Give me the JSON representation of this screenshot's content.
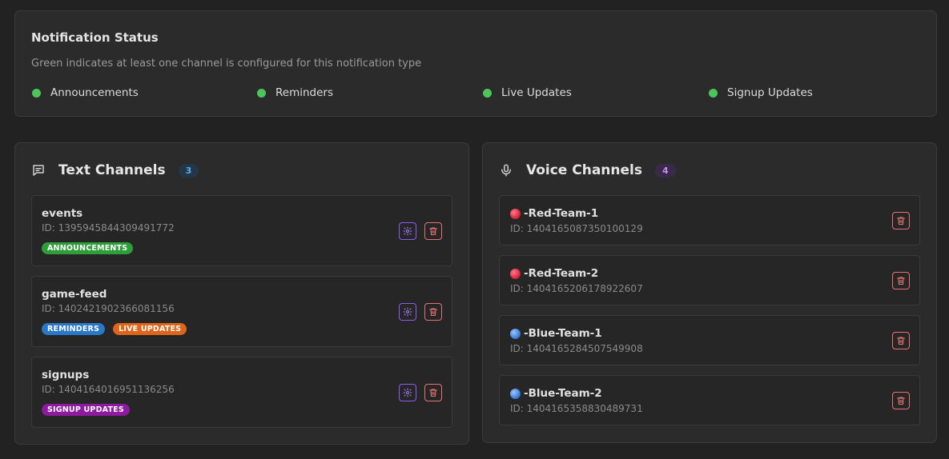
{
  "status": {
    "title": "Notification Status",
    "description": "Green indicates at least one channel is configured for this notification type",
    "items": [
      {
        "label": "Announcements",
        "active": true
      },
      {
        "label": "Reminders",
        "active": true
      },
      {
        "label": "Live Updates",
        "active": true
      },
      {
        "label": "Signup Updates",
        "active": true
      }
    ]
  },
  "text_channels": {
    "title": "Text Channels",
    "count": "3",
    "icon": "message-square-icon",
    "channels": [
      {
        "name": "events",
        "id": "ID: 1395945844309491772",
        "tags": [
          "ANNOUNCEMENTS"
        ]
      },
      {
        "name": "game-feed",
        "id": "ID: 1402421902366081156",
        "tags": [
          "REMINDERS",
          "LIVE UPDATES"
        ]
      },
      {
        "name": "signups",
        "id": "ID: 1404164016951136256",
        "tags": [
          "SIGNUP UPDATES"
        ]
      }
    ]
  },
  "voice_channels": {
    "title": "Voice Channels",
    "count": "4",
    "icon": "microphone-icon",
    "channels": [
      {
        "name": "-Red-Team-1",
        "id": "ID: 1404165087350100129",
        "emoji": "red-circle"
      },
      {
        "name": "-Red-Team-2",
        "id": "ID: 1404165206178922607",
        "emoji": "red-circle"
      },
      {
        "name": "-Blue-Team-1",
        "id": "ID: 1404165284507549908",
        "emoji": "blue-circle"
      },
      {
        "name": "-Blue-Team-2",
        "id": "ID: 1404165358830489731",
        "emoji": "blue-circle"
      }
    ]
  },
  "tag_colors": {
    "ANNOUNCEMENTS": "#2e9e3a",
    "REMINDERS": "#2a78c8",
    "LIVE UPDATES": "#e0651c",
    "SIGNUP UPDATES": "#8e1aa0"
  },
  "colors": {
    "status_active": "#4cc55a",
    "settings_accent": "#8b5cf6",
    "delete_accent": "#e57373"
  }
}
